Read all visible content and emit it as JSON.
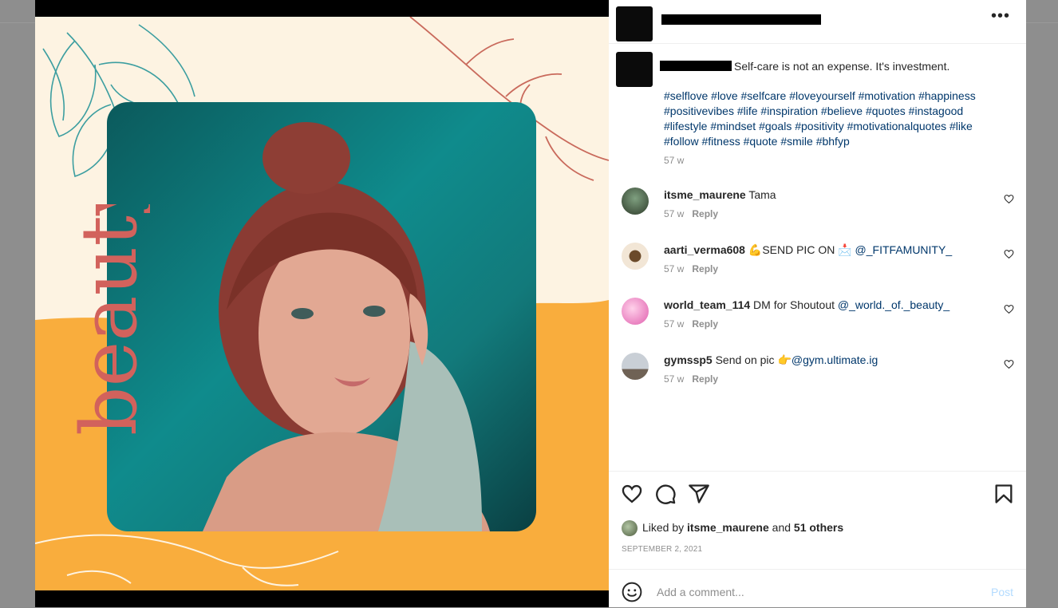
{
  "post": {
    "caption_text": "Self-care is not an expense. It's investment.",
    "hashtags": [
      "#selflove",
      "#love",
      "#selfcare",
      "#loveyourself",
      "#motivation",
      "#happiness",
      "#positivevibes",
      "#life",
      "#inspiration",
      "#believe",
      "#quotes",
      "#instagood",
      "#lifestyle",
      "#mindset",
      "#goals",
      "#positivity",
      "#motivationalquotes",
      "#like",
      "#follow",
      "#fitness",
      "#quote",
      "#smile",
      "#bhfyp"
    ],
    "caption_time": "57 w",
    "image_word": "beauty"
  },
  "comments": [
    {
      "user": "itsme_maurene",
      "text": " Tama",
      "emoji": "",
      "mention": "",
      "time": "57 w",
      "reply": "Reply"
    },
    {
      "user": "aarti_verma608",
      "text": "SEND PIC ON ",
      "emoji": "💪",
      "emoji2": "📩",
      "mention": "@_FITFAMUNITY_",
      "time": "57 w",
      "reply": "Reply"
    },
    {
      "user": "world_team_114",
      "text": " DM for Shoutout ",
      "emoji": "",
      "mention": "@_world._of._beauty_",
      "time": "57 w",
      "reply": "Reply"
    },
    {
      "user": "gymssp5",
      "text": " Send on pic ",
      "emoji": "👉",
      "mention": "@gym.ultimate.ig",
      "time": "57 w",
      "reply": "Reply"
    }
  ],
  "likes": {
    "prefix": "Liked by ",
    "user": "itsme_maurene",
    "middle": " and ",
    "others": "51 others"
  },
  "date": "SEPTEMBER 2, 2021",
  "add_comment": {
    "placeholder": "Add a comment...",
    "post_label": "Post"
  },
  "icons": {
    "more": "more-options-icon",
    "like": "heart-icon",
    "comment": "comment-icon",
    "share": "share-icon",
    "save": "bookmark-icon",
    "emoji": "emoji-icon"
  },
  "colors": {
    "link": "#00376b",
    "muted": "#8e8e8e",
    "post_disabled": "#b3dbff",
    "poster_orange": "#f9ad3d",
    "beauty_red": "#d2625c",
    "teal": "#0f8b8c"
  }
}
